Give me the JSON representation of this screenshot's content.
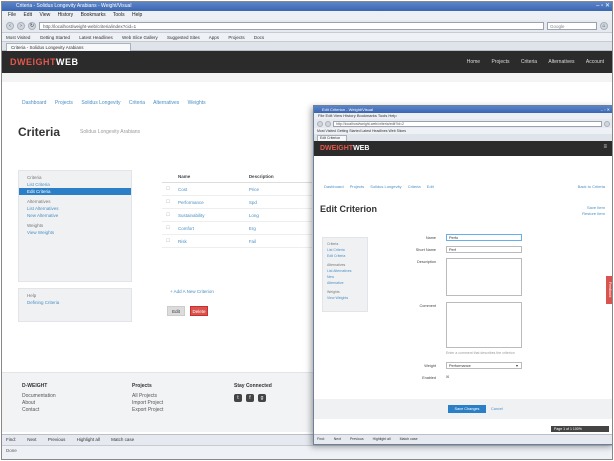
{
  "main_window": {
    "title": "Criteria - Solidus Longevity Arabians - Weight/Visual",
    "winbtns": "– ▫ ✕",
    "menu": [
      "File",
      "Edit",
      "View",
      "History",
      "Bookmarks",
      "Tools",
      "Help"
    ],
    "url": "http://localhost/weight-web/criteria/index?cid=1",
    "search_placeholder": "Google",
    "bookmarks": [
      "Most Visited",
      "Getting Started",
      "Latest Headlines",
      "Web Slice Gallery",
      "Suggested Sites",
      "Apps",
      "Projects",
      "Docs"
    ],
    "tab": "Criteria - Solidus Longevity Arabians"
  },
  "site": {
    "logo_part1": "DWEIGHT",
    "logo_part2": "WEB",
    "nav": [
      "Home",
      "Projects",
      "Criteria",
      "Alternatives",
      "Account"
    ]
  },
  "page": {
    "breadcrumbs": [
      "Dashboard",
      "Projects",
      "Solidus Longevity",
      "Criteria",
      "Alternatives",
      "Weights"
    ],
    "title": "Criteria",
    "subtitle": "Solidus Longevity Arabians",
    "sidebar": {
      "section1": "Criteria",
      "items1": [
        "List Criteria",
        "Edit Criteria"
      ],
      "section2": "Alternatives",
      "items2": [
        "List Alternatives",
        "New Alternative"
      ],
      "section3": "Weights",
      "items3": [
        "View Weights"
      ]
    },
    "sidebar2": {
      "heading": "Help",
      "item": "Defining Criteria"
    },
    "table": {
      "headers": [
        "",
        "Name",
        "Description"
      ],
      "rows": [
        [
          "☐",
          "Cost",
          "Price"
        ],
        [
          "☐",
          "Performance",
          "Spd"
        ],
        [
          "☐",
          "Sustainability",
          "Long"
        ],
        [
          "☐",
          "Comfort",
          "Erg"
        ],
        [
          "☐",
          "Risk",
          "Fail"
        ]
      ]
    },
    "add_link": "+ Add A New Criterion",
    "edit_button": "Edit",
    "delete_button": "Delete"
  },
  "footer": {
    "col1_heading": "D-WEIGHT",
    "col1_items": [
      "Documentation",
      "About",
      "Contact"
    ],
    "col2_heading": "Projects",
    "col2_items": [
      "All Projects",
      "Import Project",
      "Export Project"
    ],
    "col3_heading": "Stay Connected",
    "social": [
      "t",
      "f",
      "g"
    ]
  },
  "findbar": {
    "label": "Find:",
    "items": [
      "Next",
      "Previous",
      "Highlight all",
      "Match case"
    ]
  },
  "status": "Done",
  "popup": {
    "title": "Edit Criterion - Weight/Visual",
    "winbtns": "– ▫ ✕",
    "menu": "File  Edit  View  History  Bookmarks  Tools  Help",
    "url": "http://localhost/weight-web/criteria/edit?id=2",
    "bookmarks": "Most Visited  Getting Started  Latest Headlines  Web Slices",
    "tab": "Edit Criterion",
    "logo_part1": "DWEIGHT",
    "logo_part2": "WEB",
    "header_icon": "≡",
    "breadcrumbs": [
      "Dashboard",
      "Projects",
      "Solidus Longevity",
      "Criteria",
      "Edit"
    ],
    "breadcrumb_right": "Back to Criteria",
    "heading": "Edit Criterion",
    "links": [
      "Save Item",
      "Restore Item"
    ],
    "sidebar": {
      "h1": "Criteria",
      "i1": [
        "List Criteria",
        "Edit Criteria"
      ],
      "h2": "Alternatives",
      "i2": [
        "List Alternatives",
        "New",
        "Alternative"
      ],
      "h3": "Weights",
      "i3": [
        "View Weights"
      ]
    },
    "form": {
      "name_label": "Name",
      "name_value": "Perfo",
      "short_label": "Short Name",
      "short_value": "Perf",
      "desc_label": "Description",
      "comment_label": "Comment",
      "help_text": "Enter a comment that describes the criterion",
      "weight_label": "Weight",
      "weight_value": "Performance",
      "active_label": "Enabled",
      "active_value": "☒"
    },
    "submit": "Save Changes",
    "cancel": "Cancel",
    "feedback": "Feedback",
    "zoom": "Page 1 of 1  100%",
    "findbar": [
      "Find:",
      "Next",
      "Previous",
      "Highlight all",
      "Match case"
    ]
  }
}
